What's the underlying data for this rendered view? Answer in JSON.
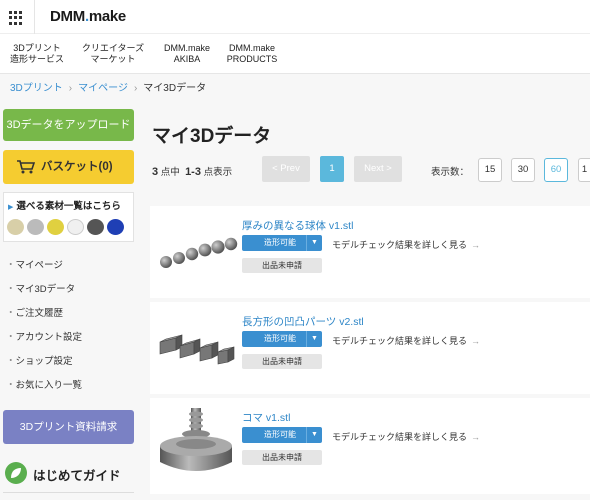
{
  "header": {
    "logo": {
      "main": "DMM",
      "dot": ".",
      "sub": "make"
    },
    "nav": [
      {
        "line1": "3Dプリント",
        "line2": "造形サービス"
      },
      {
        "line1": "クリエイターズ",
        "line2": "マーケット"
      },
      {
        "line1": "DMM.make",
        "line2": "AKIBA"
      },
      {
        "line1": "DMM.make",
        "line2": "PRODUCTS"
      }
    ]
  },
  "breadcrumb": [
    "3Dプリント",
    "マイページ",
    "マイ3Dデータ"
  ],
  "breadcrumb_sep": "›",
  "sidebar": {
    "upload_button": "3Dデータをアップロード",
    "cart_button": "バスケット(0)",
    "materials_link": "選べる素材一覧はこちら",
    "menu": [
      "マイページ",
      "マイ3Dデータ",
      "ご注文履歴",
      "アカウント設定",
      "ショップ設定",
      "お気に入り一覧"
    ],
    "request_button": "3Dプリント資料請求",
    "guide": "はじめてガイド"
  },
  "main": {
    "title": "マイ3Dデータ",
    "count": {
      "total": "3",
      "label_total": "点中",
      "range": "1-3",
      "label_range": "点表示"
    },
    "pagination": {
      "prev": "< Prev",
      "current": "1",
      "next": "Next >"
    },
    "per_page": {
      "label": "表示数：",
      "options": [
        "15",
        "30",
        "60",
        "1"
      ],
      "selected": "60"
    },
    "items": [
      {
        "name": "厚みの異なる球体 v1.stl",
        "status": "造形可能",
        "check": "モデルチェック結果を詳しく見る",
        "publish": "出品未申請",
        "thumb": "spheres-thumbnail"
      },
      {
        "name": "長方形の凹凸パーツ v2.stl",
        "status": "造形可能",
        "check": "モデルチェック結果を詳しく見る",
        "publish": "出品未申請",
        "thumb": "blocks-thumbnail"
      },
      {
        "name": "コマ v1.stl",
        "status": "造形可能",
        "check": "モデルチェック結果を詳しく見る",
        "publish": "出品未申請",
        "thumb": "spinning-top-thumbnail"
      }
    ],
    "arrow": "→",
    "caret": "▼"
  },
  "colors": {
    "upload": "#78b84a",
    "cart": "#f5cc30",
    "request": "#7a81c4",
    "link": "#2e86c7",
    "status": "#3a8fd0",
    "accent": "#5bb8dc"
  }
}
